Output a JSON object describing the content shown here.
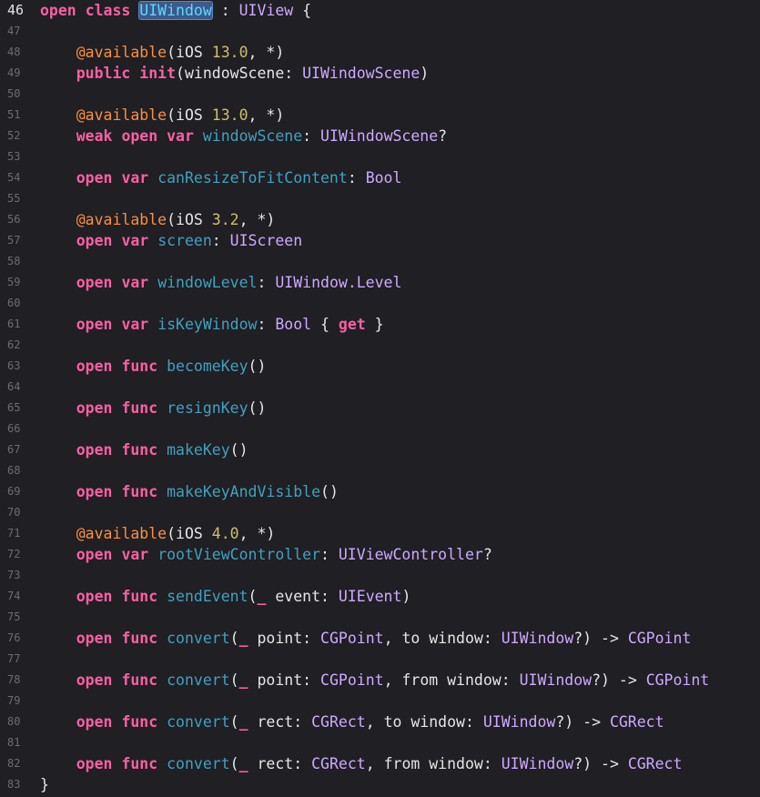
{
  "editor": {
    "lines": [
      {
        "n": "46",
        "current": true,
        "tokens": [
          [
            "kw",
            "open"
          ],
          [
            "plain",
            " "
          ],
          [
            "kw",
            "class"
          ],
          [
            "plain",
            " "
          ],
          [
            "sel",
            "UIWindow"
          ],
          [
            "plain",
            " : "
          ],
          [
            "type",
            "UIView"
          ],
          [
            "plain",
            " {"
          ]
        ]
      },
      {
        "n": "47",
        "tokens": []
      },
      {
        "n": "48",
        "tokens": [
          [
            "plain",
            "    "
          ],
          [
            "attr",
            "@available"
          ],
          [
            "plain",
            "(iOS "
          ],
          [
            "num",
            "13.0"
          ],
          [
            "plain",
            ", *)"
          ]
        ]
      },
      {
        "n": "49",
        "tokens": [
          [
            "plain",
            "    "
          ],
          [
            "kw",
            "public"
          ],
          [
            "plain",
            " "
          ],
          [
            "kw",
            "init"
          ],
          [
            "plain",
            "(windowScene: "
          ],
          [
            "type",
            "UIWindowScene"
          ],
          [
            "plain",
            ")"
          ]
        ]
      },
      {
        "n": "50",
        "tokens": []
      },
      {
        "n": "51",
        "tokens": [
          [
            "plain",
            "    "
          ],
          [
            "attr",
            "@available"
          ],
          [
            "plain",
            "(iOS "
          ],
          [
            "num",
            "13.0"
          ],
          [
            "plain",
            ", *)"
          ]
        ]
      },
      {
        "n": "52",
        "tokens": [
          [
            "plain",
            "    "
          ],
          [
            "kw",
            "weak"
          ],
          [
            "plain",
            " "
          ],
          [
            "kw",
            "open"
          ],
          [
            "plain",
            " "
          ],
          [
            "kw",
            "var"
          ],
          [
            "plain",
            " "
          ],
          [
            "decl",
            "windowScene"
          ],
          [
            "plain",
            ": "
          ],
          [
            "type",
            "UIWindowScene"
          ],
          [
            "plain",
            "?"
          ]
        ]
      },
      {
        "n": "53",
        "tokens": []
      },
      {
        "n": "54",
        "tokens": [
          [
            "plain",
            "    "
          ],
          [
            "kw",
            "open"
          ],
          [
            "plain",
            " "
          ],
          [
            "kw",
            "var"
          ],
          [
            "plain",
            " "
          ],
          [
            "decl",
            "canResizeToFitContent"
          ],
          [
            "plain",
            ": "
          ],
          [
            "type",
            "Bool"
          ]
        ]
      },
      {
        "n": "55",
        "tokens": []
      },
      {
        "n": "56",
        "tokens": [
          [
            "plain",
            "    "
          ],
          [
            "attr",
            "@available"
          ],
          [
            "plain",
            "(iOS "
          ],
          [
            "num",
            "3.2"
          ],
          [
            "plain",
            ", *)"
          ]
        ]
      },
      {
        "n": "57",
        "tokens": [
          [
            "plain",
            "    "
          ],
          [
            "kw",
            "open"
          ],
          [
            "plain",
            " "
          ],
          [
            "kw",
            "var"
          ],
          [
            "plain",
            " "
          ],
          [
            "decl",
            "screen"
          ],
          [
            "plain",
            ": "
          ],
          [
            "type",
            "UIScreen"
          ]
        ]
      },
      {
        "n": "58",
        "tokens": []
      },
      {
        "n": "59",
        "tokens": [
          [
            "plain",
            "    "
          ],
          [
            "kw",
            "open"
          ],
          [
            "plain",
            " "
          ],
          [
            "kw",
            "var"
          ],
          [
            "plain",
            " "
          ],
          [
            "decl",
            "windowLevel"
          ],
          [
            "plain",
            ": "
          ],
          [
            "type",
            "UIWindow.Level"
          ]
        ]
      },
      {
        "n": "60",
        "tokens": []
      },
      {
        "n": "61",
        "tokens": [
          [
            "plain",
            "    "
          ],
          [
            "kw",
            "open"
          ],
          [
            "plain",
            " "
          ],
          [
            "kw",
            "var"
          ],
          [
            "plain",
            " "
          ],
          [
            "decl",
            "isKeyWindow"
          ],
          [
            "plain",
            ": "
          ],
          [
            "type",
            "Bool"
          ],
          [
            "plain",
            " { "
          ],
          [
            "kw",
            "get"
          ],
          [
            "plain",
            " }"
          ]
        ]
      },
      {
        "n": "62",
        "tokens": []
      },
      {
        "n": "63",
        "tokens": [
          [
            "plain",
            "    "
          ],
          [
            "kw",
            "open"
          ],
          [
            "plain",
            " "
          ],
          [
            "kw",
            "func"
          ],
          [
            "plain",
            " "
          ],
          [
            "decl",
            "becomeKey"
          ],
          [
            "plain",
            "()"
          ]
        ]
      },
      {
        "n": "64",
        "tokens": []
      },
      {
        "n": "65",
        "tokens": [
          [
            "plain",
            "    "
          ],
          [
            "kw",
            "open"
          ],
          [
            "plain",
            " "
          ],
          [
            "kw",
            "func"
          ],
          [
            "plain",
            " "
          ],
          [
            "decl",
            "resignKey"
          ],
          [
            "plain",
            "()"
          ]
        ]
      },
      {
        "n": "66",
        "tokens": []
      },
      {
        "n": "67",
        "tokens": [
          [
            "plain",
            "    "
          ],
          [
            "kw",
            "open"
          ],
          [
            "plain",
            " "
          ],
          [
            "kw",
            "func"
          ],
          [
            "plain",
            " "
          ],
          [
            "decl",
            "makeKey"
          ],
          [
            "plain",
            "()"
          ]
        ]
      },
      {
        "n": "68",
        "tokens": []
      },
      {
        "n": "69",
        "tokens": [
          [
            "plain",
            "    "
          ],
          [
            "kw",
            "open"
          ],
          [
            "plain",
            " "
          ],
          [
            "kw",
            "func"
          ],
          [
            "plain",
            " "
          ],
          [
            "decl",
            "makeKeyAndVisible"
          ],
          [
            "plain",
            "()"
          ]
        ]
      },
      {
        "n": "70",
        "tokens": []
      },
      {
        "n": "71",
        "tokens": [
          [
            "plain",
            "    "
          ],
          [
            "attr",
            "@available"
          ],
          [
            "plain",
            "(iOS "
          ],
          [
            "num",
            "4.0"
          ],
          [
            "plain",
            ", *)"
          ]
        ]
      },
      {
        "n": "72",
        "tokens": [
          [
            "plain",
            "    "
          ],
          [
            "kw",
            "open"
          ],
          [
            "plain",
            " "
          ],
          [
            "kw",
            "var"
          ],
          [
            "plain",
            " "
          ],
          [
            "decl",
            "rootViewController"
          ],
          [
            "plain",
            ": "
          ],
          [
            "type",
            "UIViewController"
          ],
          [
            "plain",
            "?"
          ]
        ]
      },
      {
        "n": "73",
        "tokens": []
      },
      {
        "n": "74",
        "tokens": [
          [
            "plain",
            "    "
          ],
          [
            "kw",
            "open"
          ],
          [
            "plain",
            " "
          ],
          [
            "kw",
            "func"
          ],
          [
            "plain",
            " "
          ],
          [
            "decl",
            "sendEvent"
          ],
          [
            "plain",
            "("
          ],
          [
            "kw",
            "_"
          ],
          [
            "plain",
            " event: "
          ],
          [
            "type",
            "UIEvent"
          ],
          [
            "plain",
            ")"
          ]
        ]
      },
      {
        "n": "75",
        "tokens": []
      },
      {
        "n": "76",
        "tokens": [
          [
            "plain",
            "    "
          ],
          [
            "kw",
            "open"
          ],
          [
            "plain",
            " "
          ],
          [
            "kw",
            "func"
          ],
          [
            "plain",
            " "
          ],
          [
            "decl",
            "convert"
          ],
          [
            "plain",
            "("
          ],
          [
            "kw",
            "_"
          ],
          [
            "plain",
            " point: "
          ],
          [
            "type",
            "CGPoint"
          ],
          [
            "plain",
            ", to window: "
          ],
          [
            "type",
            "UIWindow"
          ],
          [
            "plain",
            "?) -> "
          ],
          [
            "type",
            "CGPoint"
          ]
        ]
      },
      {
        "n": "77",
        "tokens": []
      },
      {
        "n": "78",
        "tokens": [
          [
            "plain",
            "    "
          ],
          [
            "kw",
            "open"
          ],
          [
            "plain",
            " "
          ],
          [
            "kw",
            "func"
          ],
          [
            "plain",
            " "
          ],
          [
            "decl",
            "convert"
          ],
          [
            "plain",
            "("
          ],
          [
            "kw",
            "_"
          ],
          [
            "plain",
            " point: "
          ],
          [
            "type",
            "CGPoint"
          ],
          [
            "plain",
            ", from window: "
          ],
          [
            "type",
            "UIWindow"
          ],
          [
            "plain",
            "?) -> "
          ],
          [
            "type",
            "CGPoint"
          ]
        ]
      },
      {
        "n": "79",
        "tokens": []
      },
      {
        "n": "80",
        "tokens": [
          [
            "plain",
            "    "
          ],
          [
            "kw",
            "open"
          ],
          [
            "plain",
            " "
          ],
          [
            "kw",
            "func"
          ],
          [
            "plain",
            " "
          ],
          [
            "decl",
            "convert"
          ],
          [
            "plain",
            "("
          ],
          [
            "kw",
            "_"
          ],
          [
            "plain",
            " rect: "
          ],
          [
            "type",
            "CGRect"
          ],
          [
            "plain",
            ", to window: "
          ],
          [
            "type",
            "UIWindow"
          ],
          [
            "plain",
            "?) -> "
          ],
          [
            "type",
            "CGRect"
          ]
        ]
      },
      {
        "n": "81",
        "tokens": []
      },
      {
        "n": "82",
        "tokens": [
          [
            "plain",
            "    "
          ],
          [
            "kw",
            "open"
          ],
          [
            "plain",
            " "
          ],
          [
            "kw",
            "func"
          ],
          [
            "plain",
            " "
          ],
          [
            "decl",
            "convert"
          ],
          [
            "plain",
            "("
          ],
          [
            "kw",
            "_"
          ],
          [
            "plain",
            " rect: "
          ],
          [
            "type",
            "CGRect"
          ],
          [
            "plain",
            ", from window: "
          ],
          [
            "type",
            "UIWindow"
          ],
          [
            "plain",
            "?) -> "
          ],
          [
            "type",
            "CGRect"
          ]
        ]
      },
      {
        "n": "83",
        "tokens": [
          [
            "plain",
            "}"
          ]
        ]
      }
    ]
  },
  "colors": {
    "background": "#1f1f24",
    "keyword": "#fc5fa3",
    "attribute": "#fd8f3f",
    "number": "#d0bf69",
    "type": "#d0a8ff",
    "declaration": "#41a1c0",
    "plain": "#e6e6e6",
    "line_number": "#6c6c73",
    "selection": "#3c5a8a"
  }
}
